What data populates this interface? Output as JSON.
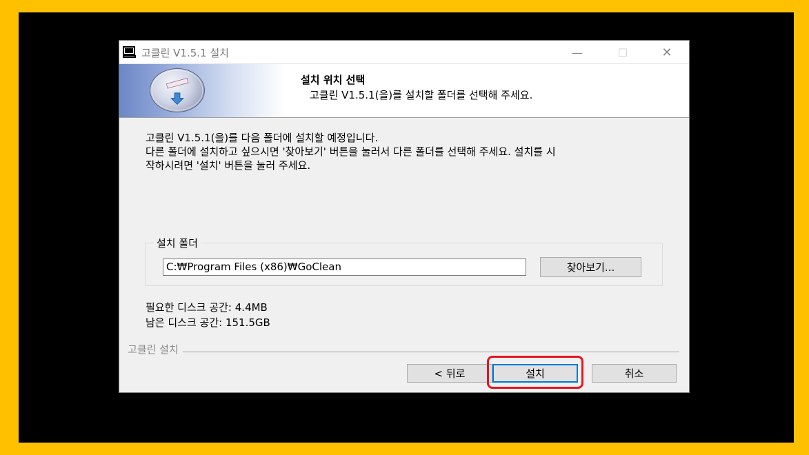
{
  "window": {
    "title": "고클린 V1.5.1 설치",
    "controls": {
      "minimize": "—",
      "maximize": "☐",
      "close": "✕"
    }
  },
  "header": {
    "title": "설치 위치 선택",
    "subtitle": "고클린 V1.5.1(을)를 설치할 폴더를 선택해 주세요."
  },
  "description": {
    "line1": "고클린 V1.5.1(을)를 다음 폴더에 설치할 예정입니다.",
    "line2": "다른 폴더에 설치하고 싶으시면 '찾아보기' 버튼을 눌러서 다른 폴더를 선택해 주세요. 설치를 시",
    "line3": "작하시려면 '설치' 버튼을 눌러 주세요."
  },
  "install_folder": {
    "label": "설치 폴더",
    "path": "C:₩Program Files (x86)₩GoClean",
    "browse_label": "찾아보기..."
  },
  "space": {
    "required": "필요한 디스크 공간: 4.4MB",
    "available": "남은 디스크 공간: 151.5GB"
  },
  "footer": {
    "label": "고클린 설치",
    "back_label": "< 뒤로",
    "install_label": "설치",
    "cancel_label": "취소"
  },
  "colors": {
    "frame": "#ffc000",
    "highlight": "#e8141c"
  },
  "icons": {
    "app": "computer-icon",
    "banner": "disc-icon"
  }
}
